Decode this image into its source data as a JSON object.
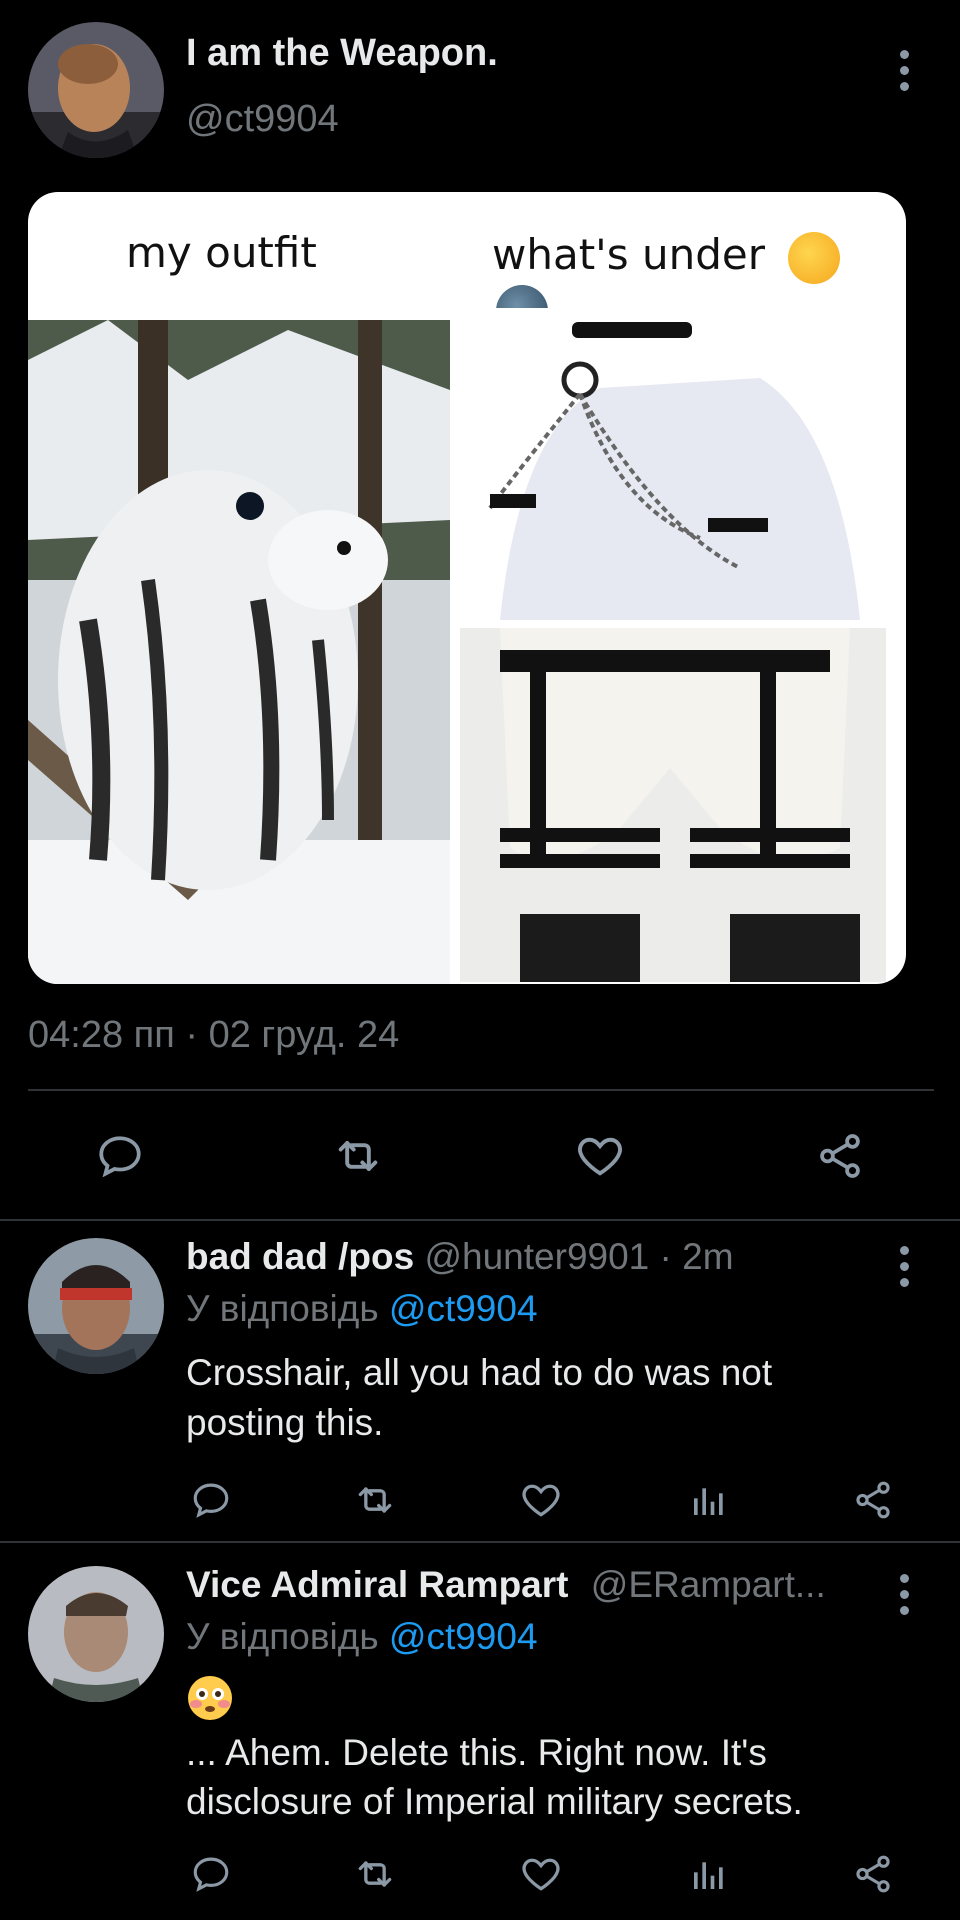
{
  "main_tweet": {
    "display_name": "I am the Weapon.",
    "handle": "@ct9904",
    "media": {
      "left_caption": "my outfit",
      "right_caption": "what's under",
      "right_emojis": [
        "hand-over-mouth-emoji",
        "new-moon-face-emoji"
      ]
    },
    "timestamp": "04:28 пп · 02 груд. 24",
    "actions": [
      "reply-icon",
      "retweet-icon",
      "like-icon",
      "share-icon"
    ]
  },
  "replies": [
    {
      "display_name": "bad dad /pos",
      "handle": "@hunter9901",
      "time": "· 2m",
      "reply_prefix": "У відповідь",
      "reply_to": "@ct9904",
      "text_line1": "Crosshair, all you had to do was not",
      "text_line2": "posting this."
    },
    {
      "display_name": "Vice Admiral Rampart",
      "handle": "@ERampart...",
      "reply_prefix": "У відповідь",
      "reply_to": "@ct9904",
      "emoji": "flushed-face-emoji",
      "text_line1": "... Ahem. Delete this. Right now. It's",
      "text_line2": "disclosure of Imperial military secrets."
    }
  ],
  "colors": {
    "background": "#000000",
    "primary_text": "#e7e9ea",
    "secondary_text": "#71767b",
    "link": "#1d9bf0",
    "divider": "#2f3336"
  }
}
